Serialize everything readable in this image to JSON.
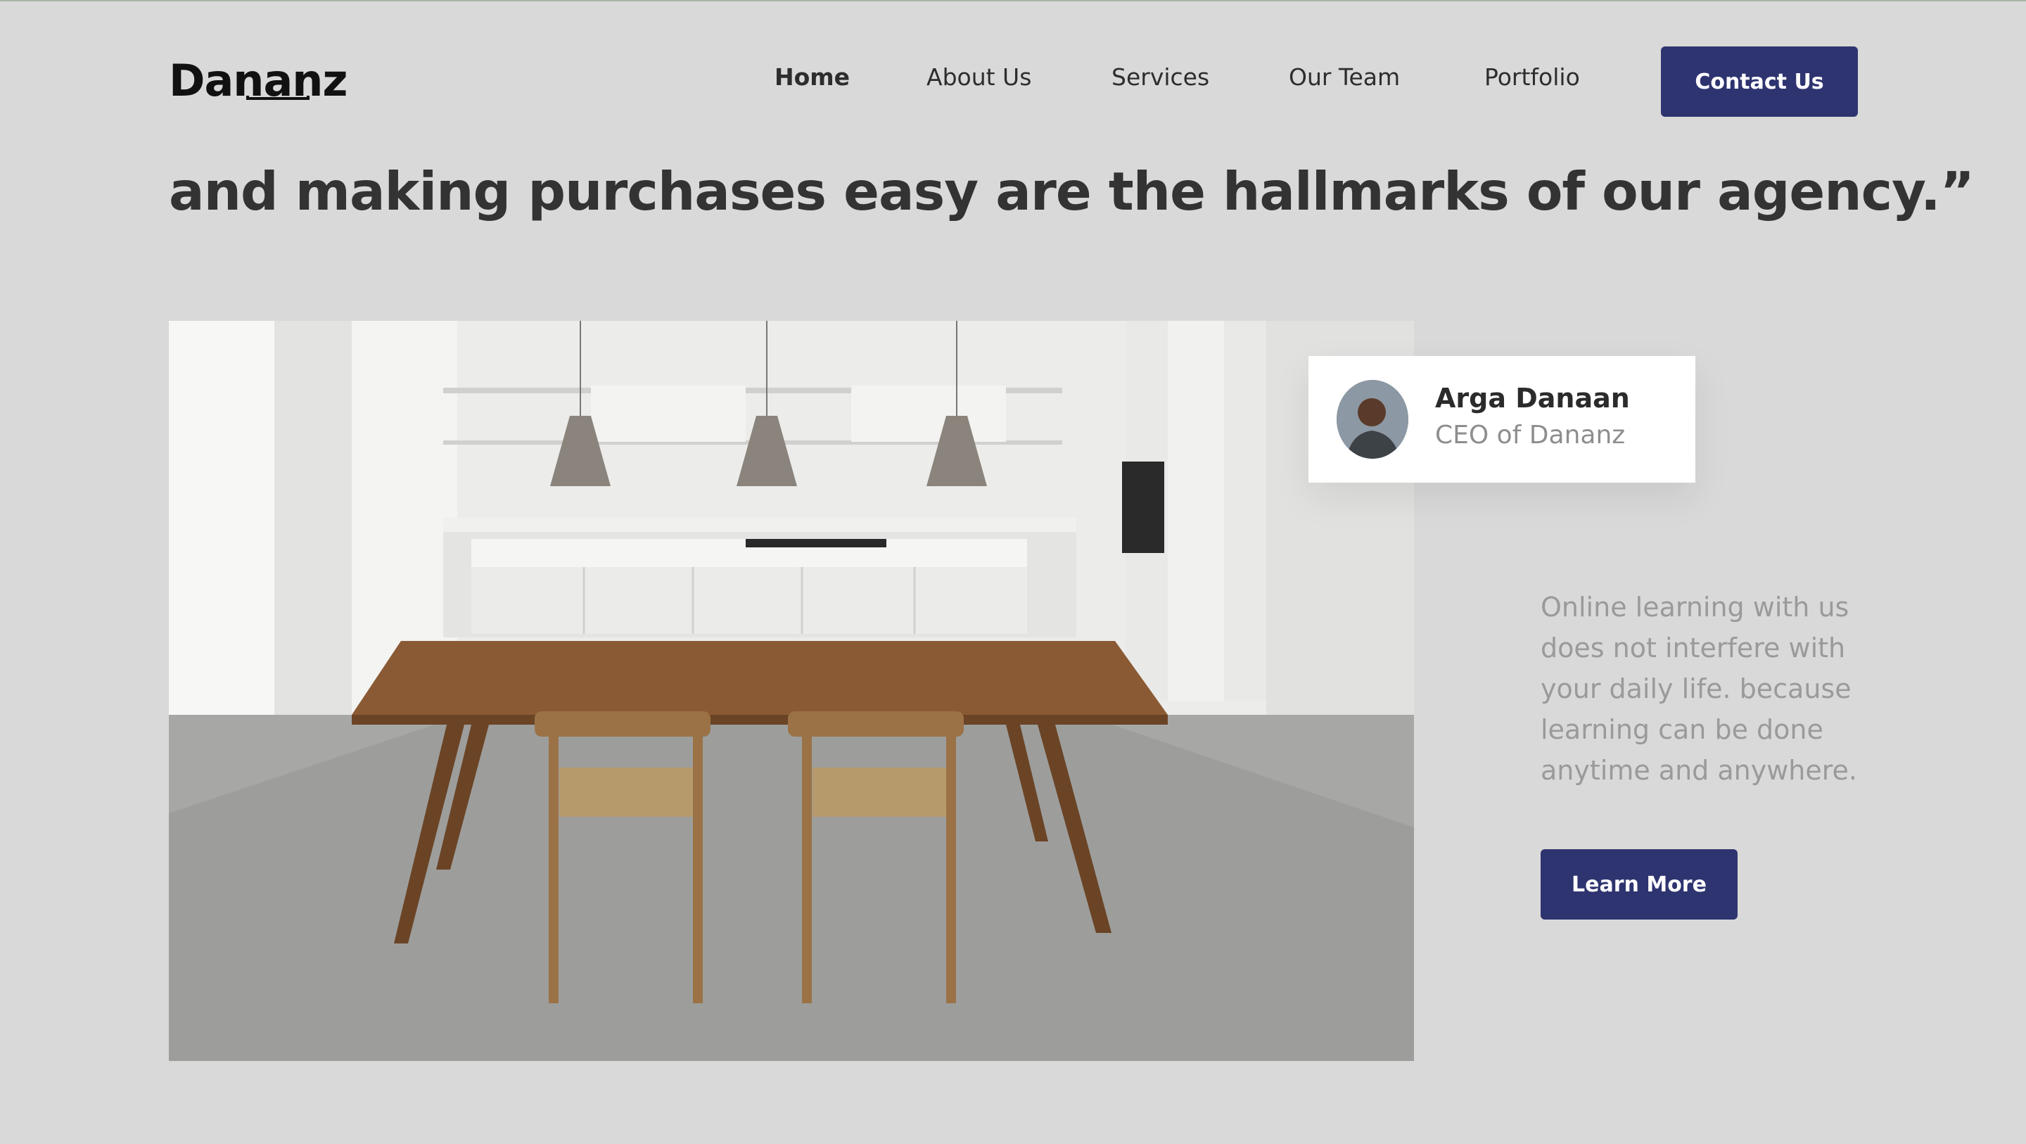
{
  "brand": {
    "logo_text": "Dananz"
  },
  "nav": {
    "items": [
      {
        "label": "Home",
        "active": true
      },
      {
        "label": "About Us",
        "active": false
      },
      {
        "label": "Services",
        "active": false
      },
      {
        "label": "Our Team",
        "active": false
      },
      {
        "label": "Portfolio",
        "active": false
      }
    ],
    "contact_label": "Contact Us"
  },
  "hero": {
    "quote": "and making purchases easy are the hallmarks of our agency.”"
  },
  "profile": {
    "name": "Arga Danaan",
    "role": "CEO of Dananz"
  },
  "content": {
    "description": "Online learning with us does not interfere with your daily life. because learning can be done anytime and anywhere.",
    "cta_label": "Learn More"
  },
  "colors": {
    "background": "#d9d9d9",
    "accent": "#2e3470",
    "heading": "#333333",
    "muted_text": "#9a9a9a"
  }
}
